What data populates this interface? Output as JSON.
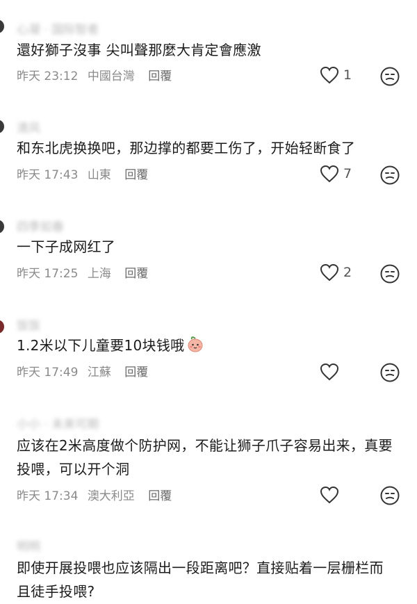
{
  "comments": [
    {
      "username": "心凝 · 国际智者",
      "text": "還好獅子沒事 尖叫聲那麼大肯定會應激",
      "time": "昨天 23:12",
      "location": "中國台灣",
      "reply": "回覆",
      "likes": "1"
    },
    {
      "username": "清风",
      "text": "和东北虎换换吧，那边撑的都要工伤了，开始轻断食了",
      "time": "昨天 17:43",
      "location": "山東",
      "reply": "回覆",
      "likes": "7"
    },
    {
      "username": "四季如春",
      "text": "一下子成网红了",
      "time": "昨天 17:25",
      "location": "上海",
      "reply": "回覆",
      "likes": "2"
    },
    {
      "username": "饭饭",
      "text": "1.2米以下儿童要10块钱哦",
      "time": "昨天 17:49",
      "location": "江蘇",
      "reply": "回覆",
      "likes": ""
    },
    {
      "username": "小小 · 未来可期",
      "text": "应该在2米高度做个防护网，不能让狮子爪子容易出来，真要投喂，可以开个洞",
      "time": "昨天 17:34",
      "location": "澳大利亞",
      "reply": "回覆",
      "likes": ""
    },
    {
      "username": "明明",
      "text": "即使开展投喂也应该隔出一段距离吧？直接贴着一层栅栏而且徒手投喂?",
      "time": "",
      "location": "",
      "reply": "",
      "likes": ""
    }
  ],
  "icons": {
    "like": "heart-outline-icon",
    "reaction": "face-emoji-icon",
    "inline_emoji": "peach-face-emoji"
  },
  "colors": {
    "meta_text": "#8a8a8a",
    "body_text": "#1b1b1b",
    "icon_stroke": "#333333",
    "peach": "#f6b6a6"
  }
}
